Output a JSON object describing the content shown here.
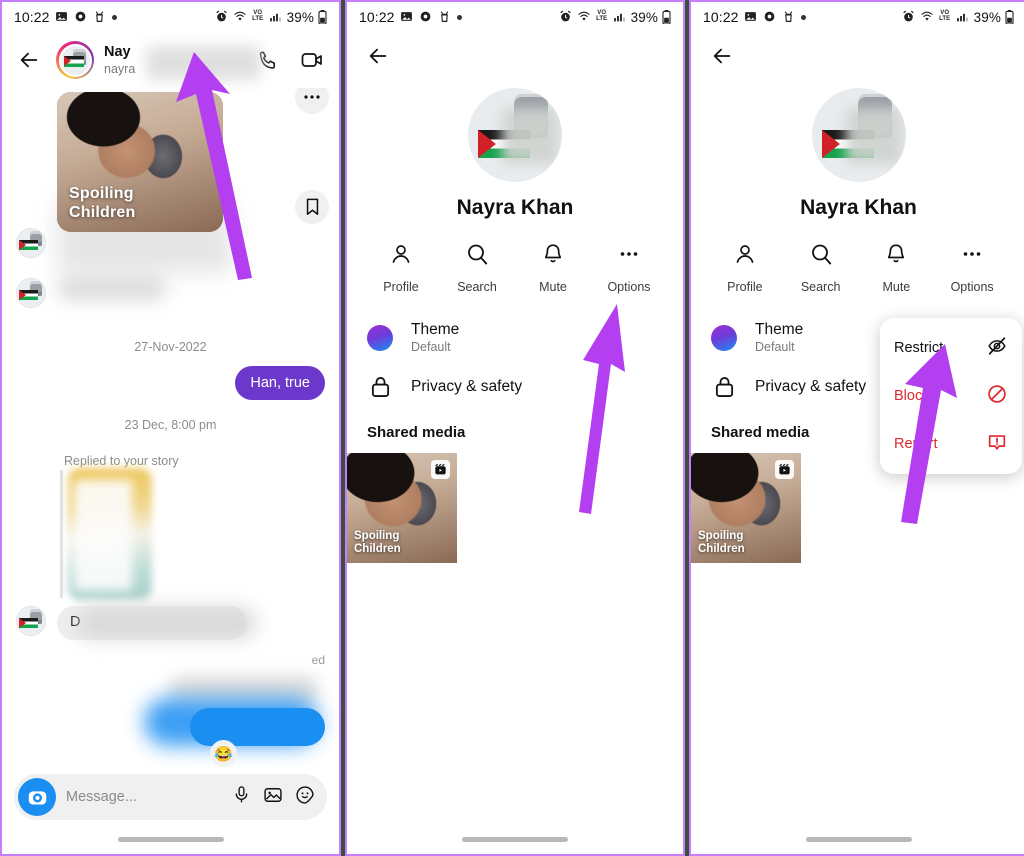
{
  "status_bar": {
    "time": "10:22",
    "battery": "39%",
    "left_icons": [
      "gallery-icon",
      "settings-icon",
      "app-icon",
      "dot-icon"
    ],
    "right_icons": [
      "alarm-icon",
      "wifi-icon",
      "volte-icon",
      "signal-icon",
      "battery-icon"
    ]
  },
  "panel1": {
    "name": "chat-thread",
    "header": {
      "back": "back-arrow-icon",
      "display_name": "Nay",
      "username": "nayra",
      "call_icon": "phone-icon",
      "video_icon": "video-camera-icon"
    },
    "shared_post": {
      "title_line1": "Spoiling",
      "title_line2": "Children",
      "save_icon": "bookmark-icon",
      "more_icon": "more-icon"
    },
    "date_separator_1": "27-Nov-2022",
    "outgoing_message": "Han, true",
    "date_separator_2": "23 Dec, 8:00 pm",
    "story_reply_label": "Replied to your story",
    "incoming_prefix": "D",
    "seen_label": "ed",
    "reaction_emoji": "😂",
    "composer": {
      "placeholder": "Message...",
      "camera_icon": "camera-icon",
      "mic_icon": "microphone-icon",
      "gallery_icon": "image-icon",
      "sticker_icon": "sticker-icon"
    }
  },
  "panel2": {
    "name": "chat-details",
    "back": "back-arrow-icon",
    "profile_name": "Nayra Khan",
    "actions": [
      {
        "label": "Profile",
        "icon": "person-icon"
      },
      {
        "label": "Search",
        "icon": "search-icon"
      },
      {
        "label": "Mute",
        "icon": "bell-icon"
      },
      {
        "label": "Options",
        "icon": "ellipsis-icon"
      }
    ],
    "theme": {
      "title": "Theme",
      "subtitle": "Default",
      "icon": "theme-circle-icon"
    },
    "privacy": {
      "title": "Privacy & safety",
      "icon": "lock-icon"
    },
    "shared_media_title": "Shared media",
    "media": [
      {
        "caption_line1": "Spoiling",
        "caption_line2": "Children",
        "badge": "reels-icon"
      }
    ]
  },
  "panel3": {
    "name": "chat-details-with-menu",
    "back": "back-arrow-icon",
    "profile_name": "Nayra Khan",
    "actions": [
      {
        "label": "Profile",
        "icon": "person-icon"
      },
      {
        "label": "Search",
        "icon": "search-icon"
      },
      {
        "label": "Mute",
        "icon": "bell-icon"
      },
      {
        "label": "Options",
        "icon": "ellipsis-icon"
      }
    ],
    "theme": {
      "title": "Theme",
      "subtitle": "Default",
      "icon": "theme-circle-icon"
    },
    "privacy": {
      "title": "Privacy & safety",
      "icon": "lock-icon"
    },
    "shared_media_title": "Shared media",
    "media": [
      {
        "caption_line1": "Spoiling",
        "caption_line2": "Children",
        "badge": "reels-icon"
      }
    ],
    "dropdown": [
      {
        "label": "Restrict",
        "icon": "eye-slash-icon",
        "style": "normal"
      },
      {
        "label": "Block",
        "icon": "block-circle-icon",
        "style": "danger"
      },
      {
        "label": "Report",
        "icon": "report-exclamation-icon",
        "style": "danger"
      }
    ]
  },
  "colors": {
    "accent_purple": "#6c38cc",
    "accent_blue": "#1b8ef2",
    "danger_red": "#e0292f",
    "annotation_arrow": "#b33ff0",
    "panel_border": "#c77dff"
  }
}
